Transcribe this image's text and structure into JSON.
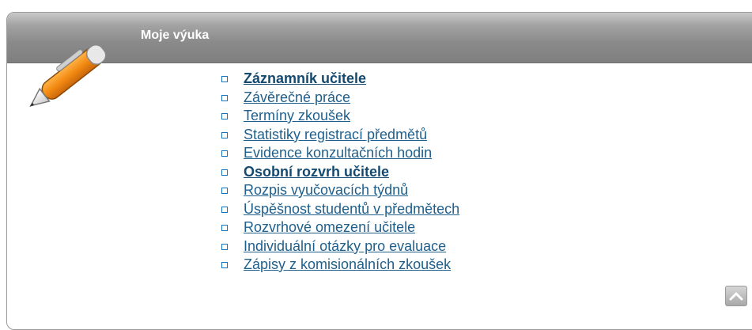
{
  "panel": {
    "title": "Moje výuka",
    "icon": "pen-icon"
  },
  "menu": {
    "items": [
      {
        "label": "Záznamník učitele",
        "bold": true
      },
      {
        "label": "Závěrečné práce",
        "bold": false
      },
      {
        "label": "Termíny zkoušek",
        "bold": false
      },
      {
        "label": "Statistiky registrací předmětů",
        "bold": false
      },
      {
        "label": "Evidence konzultačních hodin",
        "bold": false
      },
      {
        "label": "Osobní rozvrh učitele",
        "bold": true
      },
      {
        "label": "Rozpis vyučovacích týdnů",
        "bold": false
      },
      {
        "label": "Úspěšnost studentů v předmětech",
        "bold": false
      },
      {
        "label": "Rozvrhové omezení učitele",
        "bold": false
      },
      {
        "label": "Individuální otázky pro evaluace",
        "bold": false
      },
      {
        "label": "Zápisy z komisionálních zkoušek",
        "bold": false
      }
    ]
  },
  "scroll_top": {
    "icon": "chevron-up-icon"
  },
  "colors": {
    "link": "#1f5f8c",
    "bullet": "#1a73b8",
    "header": "#8a8a8a"
  }
}
